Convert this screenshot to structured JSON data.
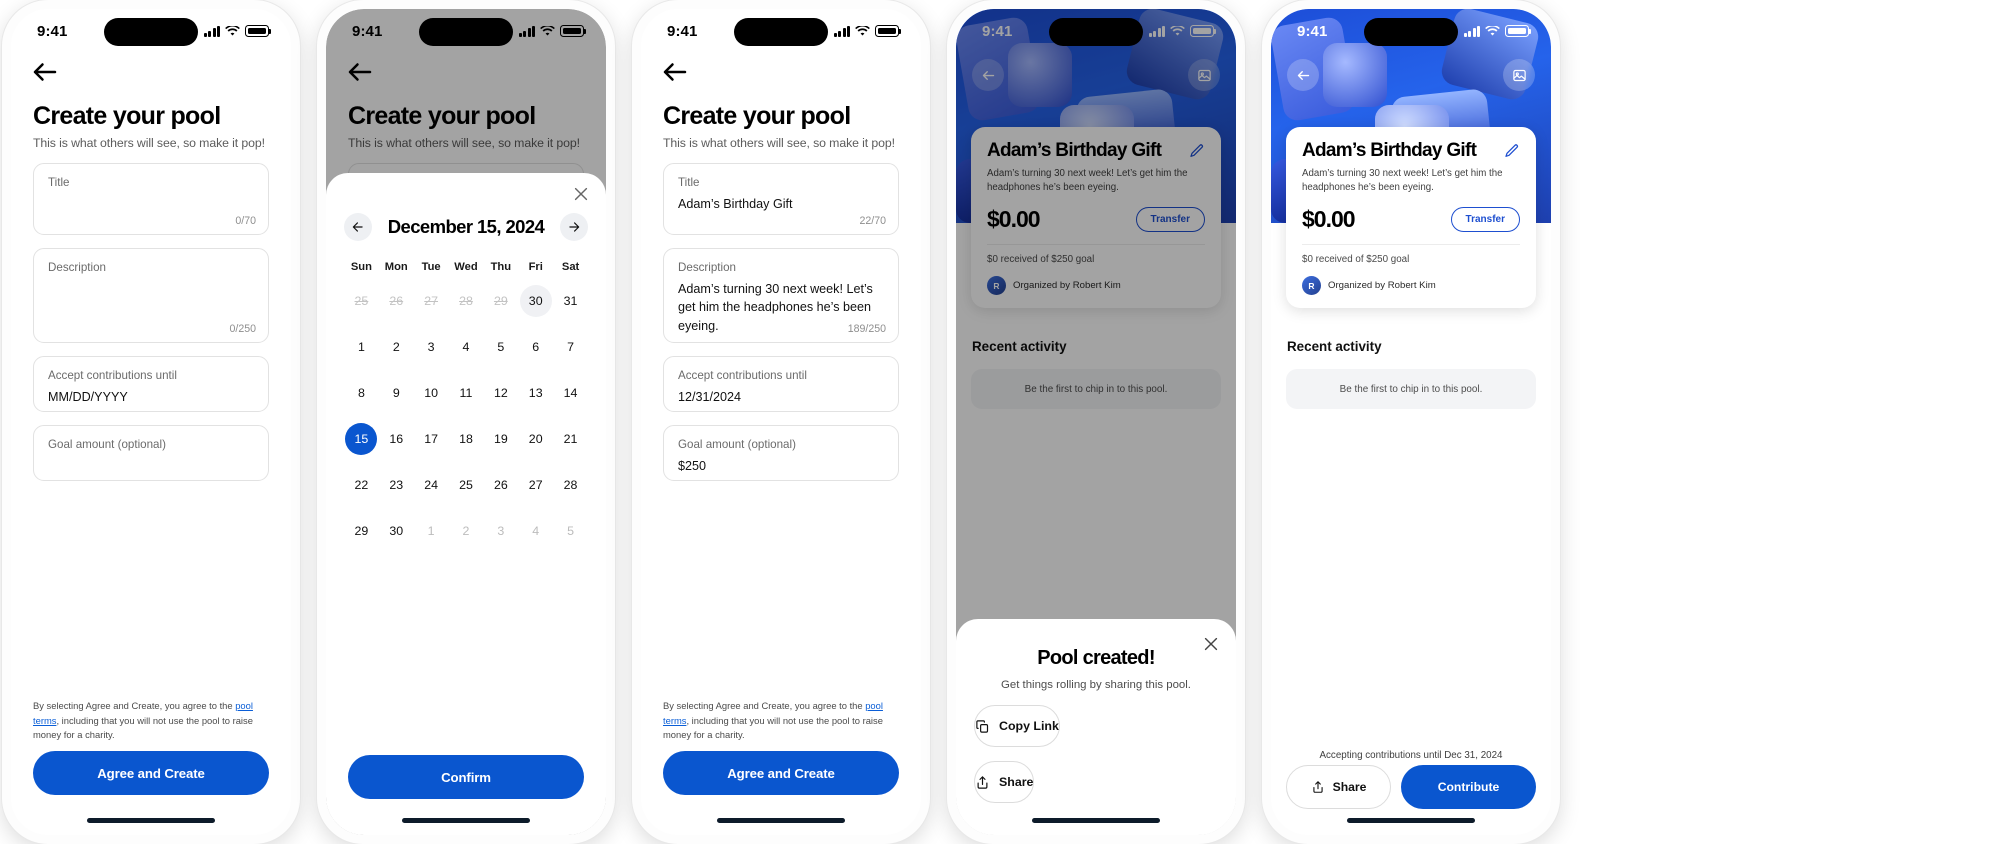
{
  "status_bar": {
    "time": "9:41",
    "icons": [
      "cellular-bars-icon",
      "wifi-icon",
      "battery-icon"
    ]
  },
  "screen1": {
    "back_icon": "back-arrow-icon",
    "title": "Create your pool",
    "subtitle": "This is what others will see, so make it pop!",
    "fields": {
      "title": {
        "label": "Title",
        "value": "",
        "counter": "0/70"
      },
      "description": {
        "label": "Description",
        "value": "",
        "counter": "0/250"
      },
      "date": {
        "label": "Accept contributions until",
        "value": "MM/DD/YYYY"
      },
      "goal": {
        "label": "Goal amount (optional)",
        "value": ""
      }
    },
    "terms_prefix": "By selecting Agree and Create, you agree to the ",
    "terms_link": "pool terms",
    "terms_suffix": ", including that you will not use the pool to raise money for a charity.",
    "cta": "Agree and Create"
  },
  "screen2": {
    "back_icon": "back-arrow-icon",
    "title": "Create your pool",
    "subtitle": "This is what others will see, so make it pop!",
    "calendar": {
      "close_icon": "close-icon",
      "prev_icon": "arrow-left-icon",
      "next_icon": "arrow-right-icon",
      "month_title": "December 15, 2024",
      "weekday_headers": [
        "Sun",
        "Mon",
        "Tue",
        "Wed",
        "Thu",
        "Fri",
        "Sat"
      ],
      "weeks": [
        [
          {
            "d": "25",
            "s": "strike"
          },
          {
            "d": "26",
            "s": "strike"
          },
          {
            "d": "27",
            "s": "strike"
          },
          {
            "d": "28",
            "s": "strike"
          },
          {
            "d": "29",
            "s": "strike"
          },
          {
            "d": "30",
            "s": "today"
          },
          {
            "d": "31",
            "s": ""
          }
        ],
        [
          {
            "d": "1",
            "s": ""
          },
          {
            "d": "2",
            "s": ""
          },
          {
            "d": "3",
            "s": ""
          },
          {
            "d": "4",
            "s": ""
          },
          {
            "d": "5",
            "s": ""
          },
          {
            "d": "6",
            "s": ""
          },
          {
            "d": "7",
            "s": ""
          }
        ],
        [
          {
            "d": "8",
            "s": ""
          },
          {
            "d": "9",
            "s": ""
          },
          {
            "d": "10",
            "s": ""
          },
          {
            "d": "11",
            "s": ""
          },
          {
            "d": "12",
            "s": ""
          },
          {
            "d": "13",
            "s": ""
          },
          {
            "d": "14",
            "s": ""
          }
        ],
        [
          {
            "d": "15",
            "s": "sel"
          },
          {
            "d": "16",
            "s": ""
          },
          {
            "d": "17",
            "s": ""
          },
          {
            "d": "18",
            "s": ""
          },
          {
            "d": "19",
            "s": ""
          },
          {
            "d": "20",
            "s": ""
          },
          {
            "d": "21",
            "s": ""
          }
        ],
        [
          {
            "d": "22",
            "s": ""
          },
          {
            "d": "23",
            "s": ""
          },
          {
            "d": "24",
            "s": ""
          },
          {
            "d": "25",
            "s": ""
          },
          {
            "d": "26",
            "s": ""
          },
          {
            "d": "27",
            "s": ""
          },
          {
            "d": "28",
            "s": ""
          }
        ],
        [
          {
            "d": "29",
            "s": ""
          },
          {
            "d": "30",
            "s": ""
          },
          {
            "d": "1",
            "s": "mute"
          },
          {
            "d": "2",
            "s": "mute"
          },
          {
            "d": "3",
            "s": "mute"
          },
          {
            "d": "4",
            "s": "mute"
          },
          {
            "d": "5",
            "s": "mute"
          }
        ]
      ],
      "confirm": "Confirm"
    }
  },
  "screen3": {
    "back_icon": "back-arrow-icon",
    "title": "Create your pool",
    "subtitle": "This is what others will see, so make it pop!",
    "fields": {
      "title": {
        "label": "Title",
        "value": "Adam’s Birthday Gift",
        "counter": "22/70"
      },
      "description": {
        "label": "Description",
        "value": "Adam’s turning 30 next week! Let’s get him the headphones he’s been eyeing.",
        "counter": "189/250"
      },
      "date": {
        "label": "Accept contributions until",
        "value": "12/31/2024"
      },
      "goal": {
        "label": "Goal amount (optional)",
        "value": "$250"
      }
    },
    "terms_prefix": "By selecting Agree and Create, you agree to the ",
    "terms_link": "pool terms",
    "terms_suffix": ", including that you will not use the pool to raise money for a charity.",
    "cta": "Agree and Create"
  },
  "screen4": {
    "back_icon": "back-arrow-icon",
    "image_icon": "image-picker-icon",
    "card": {
      "title": "Adam’s Birthday Gift",
      "description": "Adam’s turning 30 next week! Let’s get him the headphones he’s been eyeing.",
      "amount": "$0.00",
      "transfer_label": "Transfer",
      "goal_text": "$0 received of $250 goal",
      "avatar_initial": "R",
      "organizer": "Organized by Robert Kim",
      "edit_icon": "pencil-edit-icon"
    },
    "recent_activity_heading": "Recent activity",
    "empty_state": "Be the first to chip in to this pool.",
    "modal": {
      "close_icon": "close-icon",
      "heading": "Pool created!",
      "body": "Get things rolling by sharing this pool.",
      "copy_link": "Copy Link",
      "copy_icon": "copy-icon",
      "share": "Share",
      "share_icon": "share-icon"
    }
  },
  "screen5": {
    "back_icon": "back-arrow-icon",
    "image_icon": "image-picker-icon",
    "card": {
      "title": "Adam’s Birthday Gift",
      "description": "Adam’s turning 30 next week! Let’s get him the headphones he’s been eyeing.",
      "amount": "$0.00",
      "transfer_label": "Transfer",
      "goal_text": "$0 received of $250 goal",
      "avatar_initial": "R",
      "organizer": "Organized by Robert Kim",
      "edit_icon": "pencil-edit-icon"
    },
    "recent_activity_heading": "Recent activity",
    "empty_state": "Be the first to chip in to this pool.",
    "accepting_note": "Accepting contributions until Dec 31, 2024",
    "share_button": "Share",
    "share_icon": "share-icon",
    "contribute_button": "Contribute"
  },
  "colors": {
    "accent": "#0a56cf",
    "link": "#0a5ed7",
    "hero": "#2563eb",
    "muted": "#8e8e8e"
  }
}
